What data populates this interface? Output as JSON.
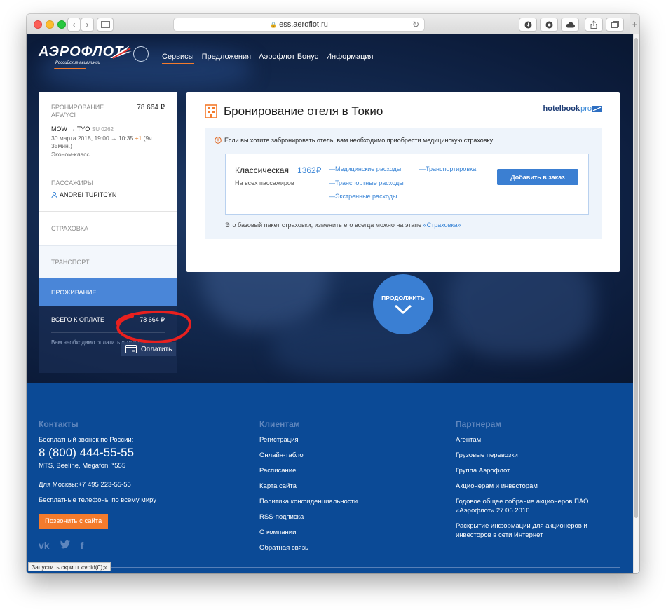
{
  "browser": {
    "url": "ess.aeroflot.ru"
  },
  "header": {
    "logo_text": "АЭРОФЛОТ",
    "logo_subtitle": "Российские авиалинии",
    "nav": [
      {
        "label": "Сервисы",
        "active": true
      },
      {
        "label": "Предложения",
        "active": false
      },
      {
        "label": "Аэрофлот Бонус",
        "active": false
      },
      {
        "label": "Информация",
        "active": false
      }
    ]
  },
  "sidebar": {
    "booking_label": "БРОНИРОВАНИЕ",
    "booking_code": "AFWYCI",
    "booking_price": "78 664 ₽",
    "route": "MOW → TYO",
    "flight": "SU 0262",
    "date": "30 марта 2018, 19:00 → 10:35",
    "plus_day": "+1",
    "duration": "(9ч. 35мин.)",
    "cabin": "Эконом-класс",
    "passengers_label": "ПАССАЖИРЫ",
    "passenger_name": "ANDREI TUPITCYN",
    "insurance_label": "СТРАХОВКА",
    "transport_label": "ТРАНСПОРТ",
    "accommodation_label": "ПРОЖИВАНИЕ",
    "total_label": "ВСЕГО К ОПЛАТЕ",
    "total_price": "78 664 ₽",
    "total_note": "Вам необходимо оплатить в течение:",
    "pay_label": "Оплатить"
  },
  "main": {
    "title": "Бронирование отеля в Токио",
    "partner_brand": "hotelbook",
    "partner_brand_suffix": "pro",
    "warning": "Если вы хотите забронировать отель, вам необходимо приобрести медицинскую страховку",
    "offer": {
      "name": "Классическая",
      "price": "1362₽",
      "subtitle": "На всех пассажиров",
      "options": [
        "—Медицинские расходы",
        "—Транспортные расходы",
        "—Экстренные расходы",
        "—Транспортировка"
      ],
      "add_label": "Добавить в заказ"
    },
    "note": "Это базовый пакет страховки, изменить его всегда можно на этапе",
    "note_link": "«Страховка»"
  },
  "continue_label": "ПРОДОЛЖИТЬ",
  "footer": {
    "contacts": {
      "heading": "Контакты",
      "free_call": "Бесплатный звонок по России:",
      "phone": "8 (800) 444-55-55",
      "operators": "MTS, Beeline, Megafon: *555",
      "moscow": "Для Москвы:+7 495 223-55-55",
      "free_world": "Бесплатные телефоны по всему миру",
      "call_button": "Позвонить с сайта",
      "social": [
        "vk",
        "twitter",
        "f"
      ]
    },
    "clients": {
      "heading": "Клиентам",
      "items": [
        "Регистрация",
        "Онлайн-табло",
        "Расписание",
        "Карта сайта",
        "Политика конфиденциальности",
        "RSS-подписка",
        "О компании",
        "Обратная связь"
      ]
    },
    "partners": {
      "heading": "Партнерам",
      "items": [
        "Агентам",
        "Грузовые перевозки",
        "Группа Аэрофлот",
        "Акционерам и инвесторам",
        "Годовое общее собрание акционеров ПАО «Аэрофлот» 27.06.2016",
        "Раскрытие информации для акционеров и инвесторов в сети Интернет"
      ]
    }
  },
  "status_bar": "Запустить скрипт «void(0);»",
  "colors": {
    "accent_blue": "#3a7fd3",
    "brand_orange": "#f47b2c",
    "footer_blue": "#0b4a96",
    "annotation_red": "#e8201f"
  }
}
